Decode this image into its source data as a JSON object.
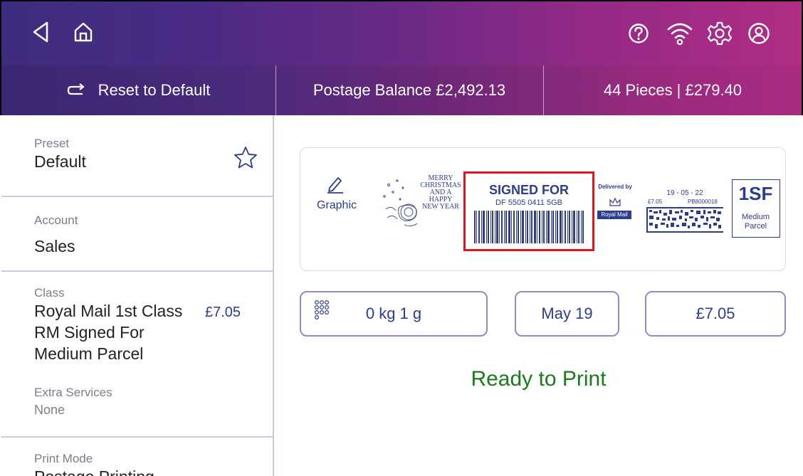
{
  "topbar": {
    "icons": [
      "back-icon",
      "home-icon",
      "help-icon",
      "wifi-icon",
      "settings-icon",
      "account-icon"
    ]
  },
  "subbar": {
    "reset_label": "Reset to Default",
    "postage_balance": "Postage Balance £2,492.13",
    "pieces_summary": "44 Pieces | £279.40"
  },
  "sidebar": {
    "preset_label": "Preset",
    "preset_value": "Default",
    "account_label": "Account",
    "account_value": "Sales",
    "class_label": "Class",
    "class_line1": "Royal Mail 1st Class",
    "class_price": "£7.05",
    "class_line2": "RM Signed For",
    "class_line3": "Medium Parcel",
    "extra_label": "Extra Services",
    "extra_value": "None",
    "print_mode_label": "Print Mode",
    "print_mode_value": "Postage Printing"
  },
  "indicia": {
    "graphic_label": "Graphic",
    "graphic_text": [
      "MERRY",
      "CHRISTMAS",
      "AND A",
      "HAPPY",
      "NEW YEAR"
    ],
    "signed_for_title": "SIGNED FOR",
    "tracking_number": "DF 5505 0411 5GB",
    "delivered_by": "Delivered by",
    "royal_mail": "Royal Mail",
    "date": "19 - 05 - 22",
    "amount": "£7.05",
    "meter_id": "PB8000018",
    "service_code": "1SF",
    "service_line1": "Medium",
    "service_line2": "Parcel"
  },
  "fields": {
    "weight": "0 kg 1 g",
    "date": "May 19",
    "postage": "£7.05"
  },
  "status": "Ready to Print",
  "colors": {
    "accent": "#2c3d8f",
    "status_ready": "#1b7a1b",
    "highlight_box": "#e0161b"
  }
}
